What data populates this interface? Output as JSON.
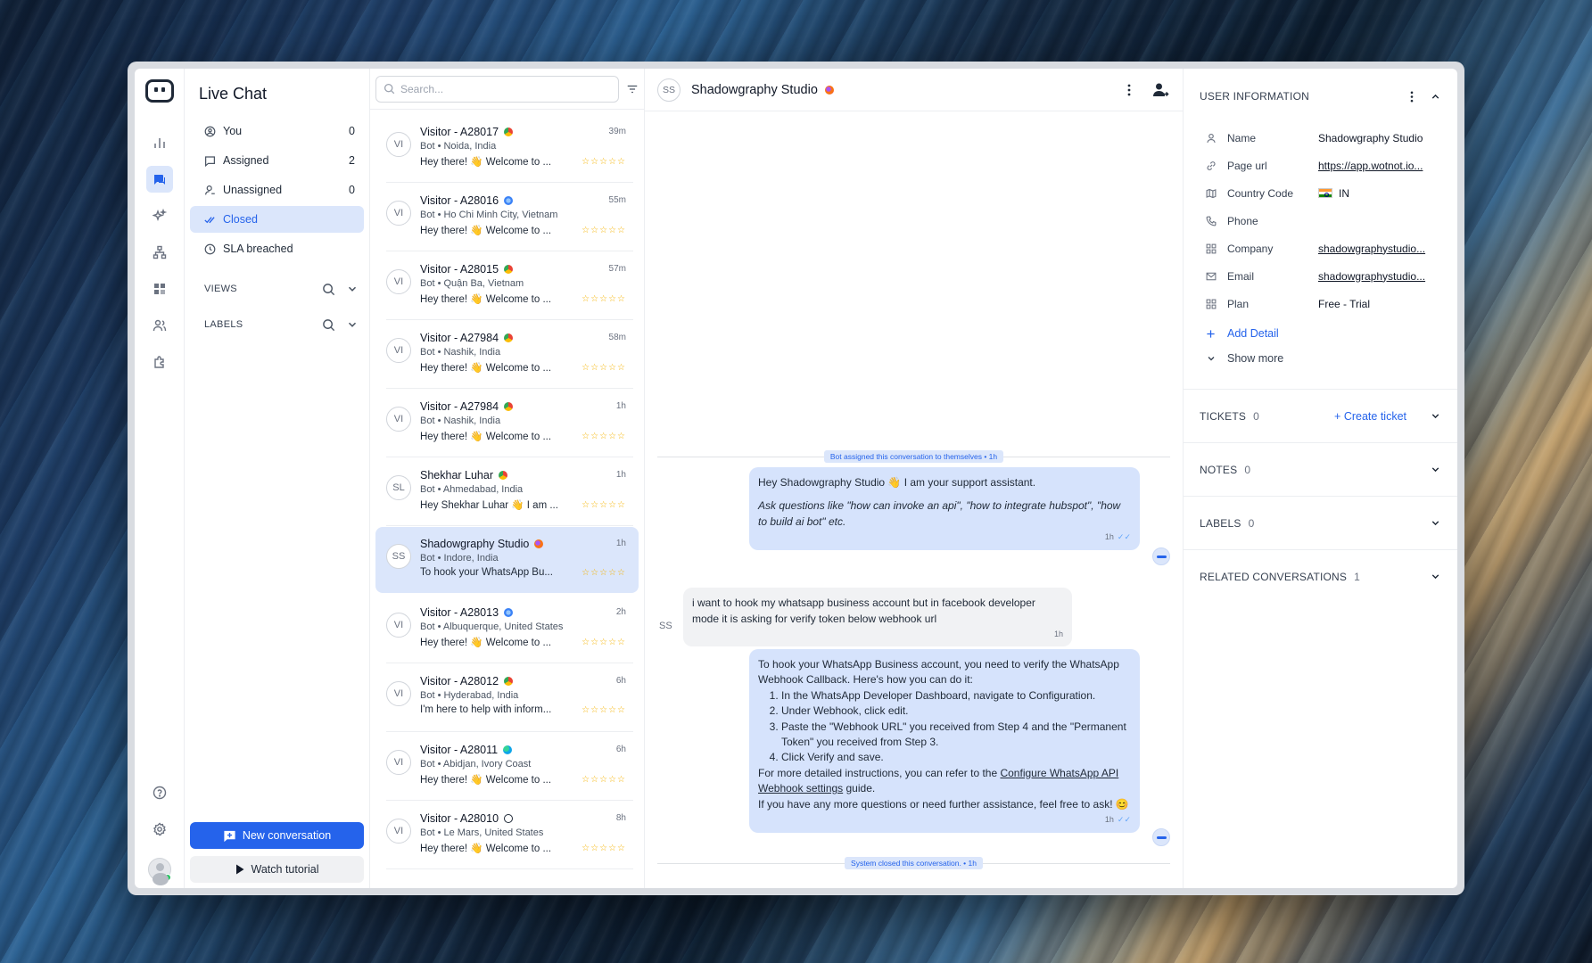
{
  "inbox": {
    "title": "Live Chat",
    "items": [
      {
        "label": "You",
        "count": "0",
        "icon": "user-circle-icon"
      },
      {
        "label": "Assigned",
        "count": "2",
        "icon": "message-square-icon"
      },
      {
        "label": "Unassigned",
        "count": "0",
        "icon": "user-minus-icon"
      },
      {
        "label": "Closed",
        "count": "",
        "icon": "double-check-icon"
      },
      {
        "label": "SLA breached",
        "count": "",
        "icon": "clock-icon"
      }
    ],
    "views_label": "VIEWS",
    "labels_label": "LABELS",
    "new_conversation": "New conversation",
    "watch_tutorial": "Watch tutorial"
  },
  "search": {
    "placeholder": "Search..."
  },
  "conversations": [
    {
      "initials": "VI",
      "name": "Visitor - A28017",
      "time": "39m",
      "sub": "Bot • Noida, India",
      "preview": "Hey there! 👋 Welcome to ...",
      "browser": "chrome"
    },
    {
      "initials": "VI",
      "name": "Visitor - A28016",
      "time": "55m",
      "sub": "Bot • Ho Chi Minh City, Vietnam",
      "preview": "Hey there! 👋 Welcome to ...",
      "browser": "safari"
    },
    {
      "initials": "VI",
      "name": "Visitor - A28015",
      "time": "57m",
      "sub": "Bot • Quận Ba, Vietnam",
      "preview": "Hey there! 👋 Welcome to ...",
      "browser": "chrome"
    },
    {
      "initials": "VI",
      "name": "Visitor - A27984",
      "time": "58m",
      "sub": "Bot • Nashik, India",
      "preview": "Hey there! 👋 Welcome to ...",
      "browser": "chrome"
    },
    {
      "initials": "VI",
      "name": "Visitor - A27984",
      "time": "1h",
      "sub": "Bot • Nashik, India",
      "preview": "Hey there! 👋 Welcome to ...",
      "browser": "chrome"
    },
    {
      "initials": "SL",
      "name": "Shekhar Luhar",
      "time": "1h",
      "sub": "Bot • Ahmedabad, India",
      "preview": "Hey Shekhar Luhar 👋 I am ...",
      "browser": "chrome"
    },
    {
      "initials": "SS",
      "name": "Shadowgraphy Studio",
      "time": "1h",
      "sub": "Bot • Indore, India",
      "preview": "To hook your WhatsApp Bu...",
      "browser": "firefox",
      "selected": true
    },
    {
      "initials": "VI",
      "name": "Visitor - A28013",
      "time": "2h",
      "sub": "Bot • Albuquerque, United States",
      "preview": "Hey there! 👋 Welcome to ...",
      "browser": "safari"
    },
    {
      "initials": "VI",
      "name": "Visitor - A28012",
      "time": "6h",
      "sub": "Bot • Hyderabad, India",
      "preview": "I'm here to help with inform...",
      "browser": "chrome"
    },
    {
      "initials": "VI",
      "name": "Visitor - A28011",
      "time": "6h",
      "sub": "Bot • Abidjan, Ivory Coast",
      "preview": "Hey there! 👋 Welcome to ...",
      "browser": "edge"
    },
    {
      "initials": "VI",
      "name": "Visitor - A28010",
      "time": "8h",
      "sub": "Bot • Le Mars, United States",
      "preview": "Hey there! 👋 Welcome to ...",
      "browser": "globe"
    }
  ],
  "rating_stars": "☆☆☆☆☆",
  "chat": {
    "avatar": "SS",
    "title": "Shadowgraphy Studio",
    "sys_assigned": "Bot assigned this conversation to themselves • 1h",
    "sys_closed": "System closed this conversation. • 1h",
    "msg1_line1": "Hey Shadowgraphy Studio 👋 I am your support assistant.",
    "msg1_line2": "Ask questions like \"how can invoke an api\", \"how to integrate hubspot\", \"how to build ai bot\" etc.",
    "msg1_time": "1h",
    "msg2_text": "i want to hook my whatsapp business account but in facebook developer mode it is asking for verify token below webhook url",
    "msg2_time": "1h",
    "msg2_avatar": "SS",
    "msg3_intro": "To hook your WhatsApp Business account, you need to verify the WhatsApp Webhook Callback. Here's how you can do it:",
    "msg3_steps": [
      "In the WhatsApp Developer Dashboard, navigate to Configuration.",
      "Under Webhook, click edit.",
      "Paste the \"Webhook URL\" you received from Step 4 and the \"Permanent Token\" you received from Step 3.",
      "Click Verify and save."
    ],
    "msg3_more_pre": "For more detailed instructions, you can refer to the ",
    "msg3_more_link": "Configure WhatsApp API Webhook settings",
    "msg3_more_post": " guide.",
    "msg3_outro": "If you have any more questions or need further assistance, feel free to ask! 😊",
    "msg3_time": "1h"
  },
  "info": {
    "title": "USER INFORMATION",
    "fields": [
      {
        "key": "Name",
        "value": "Shadowgraphy Studio"
      },
      {
        "key": "Page url",
        "value": "https://app.wotnot.io..."
      },
      {
        "key": "Country Code",
        "value": "IN"
      },
      {
        "key": "Phone",
        "value": ""
      },
      {
        "key": "Company",
        "value": "shadowgraphystudio..."
      },
      {
        "key": "Email",
        "value": "shadowgraphystudio..."
      },
      {
        "key": "Plan",
        "value": "Free - Trial"
      }
    ],
    "add_detail": "Add Detail",
    "show_more": "Show more",
    "tickets_label": "TICKETS",
    "tickets_count": "0",
    "create_ticket": "Create ticket",
    "notes_label": "NOTES",
    "notes_count": "0",
    "labels_label": "LABELS",
    "labels_count": "0",
    "related_label": "RELATED CONVERSATIONS",
    "related_count": "1"
  }
}
